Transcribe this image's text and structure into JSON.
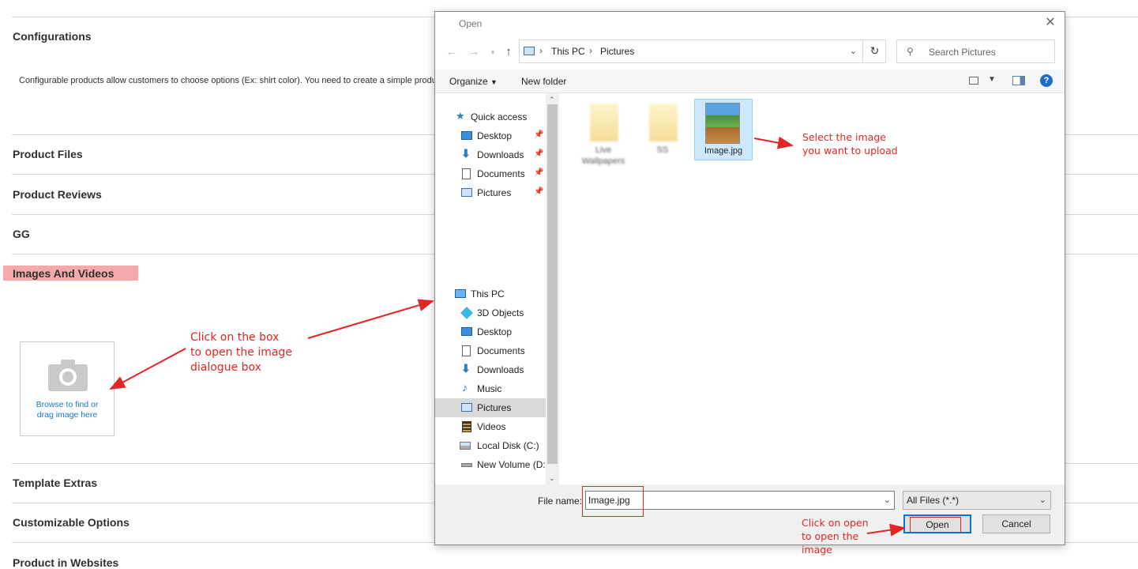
{
  "page": {
    "sections": {
      "configurations": "Configurations",
      "configurations_note": "Configurable products allow customers to choose options (Ex: shirt color). You need to create a simple product for each configuration (Ex: a product for each color).",
      "product_files": "Product Files",
      "product_reviews": "Product Reviews",
      "gg": "GG",
      "images_and_videos": "Images And Videos",
      "template_extras": "Template Extras",
      "customizable_options": "Customizable Options",
      "product_in_websites": "Product in Websites"
    },
    "upload_box": {
      "line1": "Browse to find or",
      "line2": "drag image here"
    }
  },
  "annotations": {
    "click_box": [
      "Click on the box",
      "to open the image",
      "dialogue box"
    ],
    "select_image": [
      "Select the image",
      "you want to upload"
    ],
    "click_open": [
      "Click on open",
      "to open the",
      "image"
    ],
    "color": "#e22626"
  },
  "dialog": {
    "title": "Open",
    "breadcrumb": [
      "This PC",
      "Pictures"
    ],
    "search_placeholder": "Search Pictures",
    "toolbar": {
      "organize": "Organize",
      "new_folder": "New folder"
    },
    "nav": {
      "quick_access": "Quick access",
      "quick_items": [
        "Desktop",
        "Downloads",
        "Documents",
        "Pictures"
      ],
      "this_pc": "This PC",
      "pc_items": [
        "3D Objects",
        "Desktop",
        "Documents",
        "Downloads",
        "Music",
        "Pictures",
        "Videos",
        "Local Disk (C:)",
        "New Volume (D:"
      ],
      "selected": "Pictures"
    },
    "files": [
      {
        "name": "Live Wallpapers",
        "line1": "Live",
        "line2": "Wallpapers",
        "icon": "folder-icon"
      },
      {
        "name": "SS",
        "line1": "SS",
        "icon": "folder-icon"
      },
      {
        "name": "Image.jpg",
        "line1": "Image.jpg",
        "icon": "image-thumbnail",
        "selected": true
      }
    ],
    "file_name_label": "File name:",
    "file_name_value": "Image.jpg",
    "file_type": "All Files (*.*)",
    "open_button": "Open",
    "cancel_button": "Cancel"
  }
}
